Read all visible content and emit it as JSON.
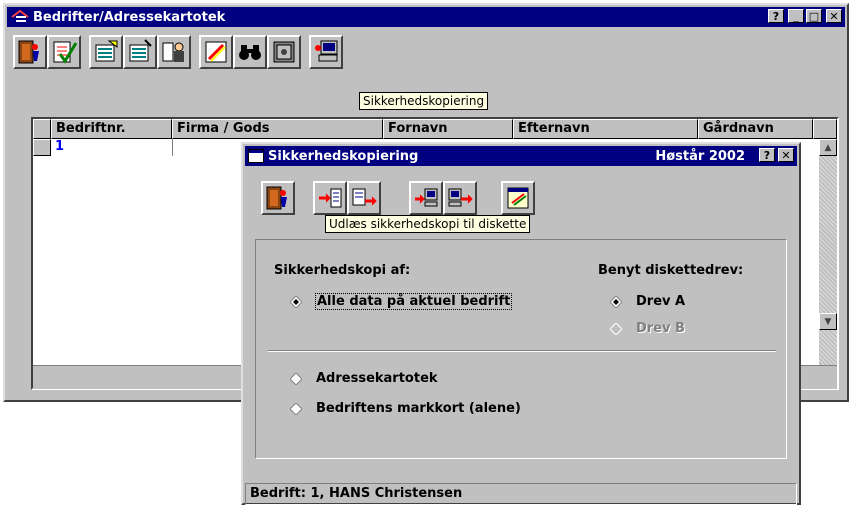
{
  "main_window": {
    "title": "Bedrifter/Adressekartotek",
    "help_btn": "?",
    "min_btn": "_",
    "max_btn": "□",
    "close_btn": "✕",
    "toolbar_tooltip": "Sikkerhedskopiering",
    "toolbar_icons": [
      "exit-icon",
      "approve-icon",
      "edit-list-icon",
      "list-icon",
      "person-list-icon",
      "pencil-icon",
      "binoculars-icon",
      "safe-icon",
      "backup-computer-icon"
    ],
    "table": {
      "columns": [
        "",
        "Bedriftnr.",
        "Firma / Gods",
        "Fornavn",
        "Efternavn",
        "Gårdnavn",
        ""
      ],
      "rows": [
        {
          "bedriftnr": "1"
        }
      ]
    }
  },
  "dialog": {
    "title": "Sikkerhedskopiering",
    "season": "Høstår 2002",
    "help_btn": "?",
    "close_btn": "✕",
    "tooltip": "Udlæs sikkerhedskopi til diskette",
    "toolbar_icons": [
      "exit-icon",
      "export-disk-icon",
      "export-disk-alt-icon",
      "import-computer-icon",
      "import-computer-alt-icon",
      "notes-icon"
    ],
    "backup_of_label": "Sikkerhedskopi af:",
    "drive_label": "Benyt diskettedrev:",
    "options": {
      "all_data": "Alle data på aktuel bedrift",
      "address": "Adressekartotek",
      "field_map": "Bedriftens markkort (alene)"
    },
    "drives": {
      "a": "Drev A",
      "b": "Drev B"
    },
    "status": "Bedrift: 1, HANS Christensen"
  },
  "colors": {
    "titlebar": "#000080",
    "face": "#c0c0c0",
    "tooltip": "#ffffe1",
    "link_blue": "#0000ff"
  }
}
